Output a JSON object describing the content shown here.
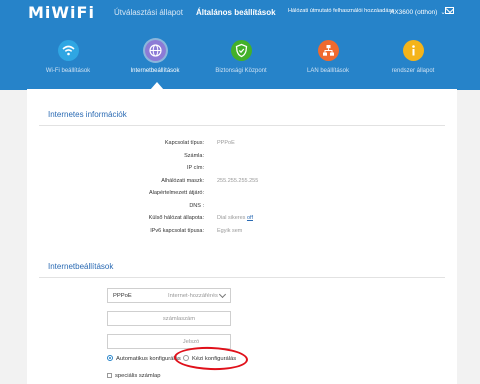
{
  "header": {
    "logo": "MiWiFi",
    "nav_status": "Útválasztási állapot",
    "nav_settings": "Általános beállítások",
    "nav_extra": "Hálózati útmutató felhasználói hozzáadása",
    "device": "AX3600 (otthon)"
  },
  "tabs": [
    {
      "label": "Wi-Fi beállítások",
      "color": "#2fa6e3",
      "icon": "wifi-icon"
    },
    {
      "label": "Internetbeállítások",
      "color": "#8c7bd6",
      "icon": "globe-icon"
    },
    {
      "label": "Biztonsági Központ",
      "color": "#43b02a",
      "icon": "shield-icon"
    },
    {
      "label": "LAN beállítások",
      "color": "#ef6a2f",
      "icon": "network-icon"
    },
    {
      "label": "rendszer állapot",
      "color": "#f4b41a",
      "icon": "info-icon"
    }
  ],
  "internet_info": {
    "title": "Internetes információk",
    "rows": [
      {
        "label": "Kapcsolat típus:",
        "value": "PPPoE"
      },
      {
        "label": "Számla:",
        "value": ""
      },
      {
        "label": "IP cím:",
        "value": ""
      },
      {
        "label": "Alhálózati maszk:",
        "value": "255.255.255.255"
      },
      {
        "label": "Alapértelmezett átjáró:",
        "value": ""
      },
      {
        "label": "DNS :",
        "value": ""
      },
      {
        "label": "Külső hálózat állapota:",
        "value": "Dial sikeres",
        "link": "off"
      },
      {
        "label": "IPv6 kapcsolat típusa:",
        "value": "Egyik sem"
      }
    ]
  },
  "internet_settings": {
    "title": "Internetbeállítások",
    "select_value": "PPPoE",
    "select_hint": "Internet-hozzáférés",
    "username_placeholder": "számlaszám",
    "password_placeholder": "Jelszó",
    "radio_auto": "Automatikus konfigurálás",
    "radio_manual": "Kézi konfigurálás",
    "checkbox_label": "speciális számlap"
  }
}
